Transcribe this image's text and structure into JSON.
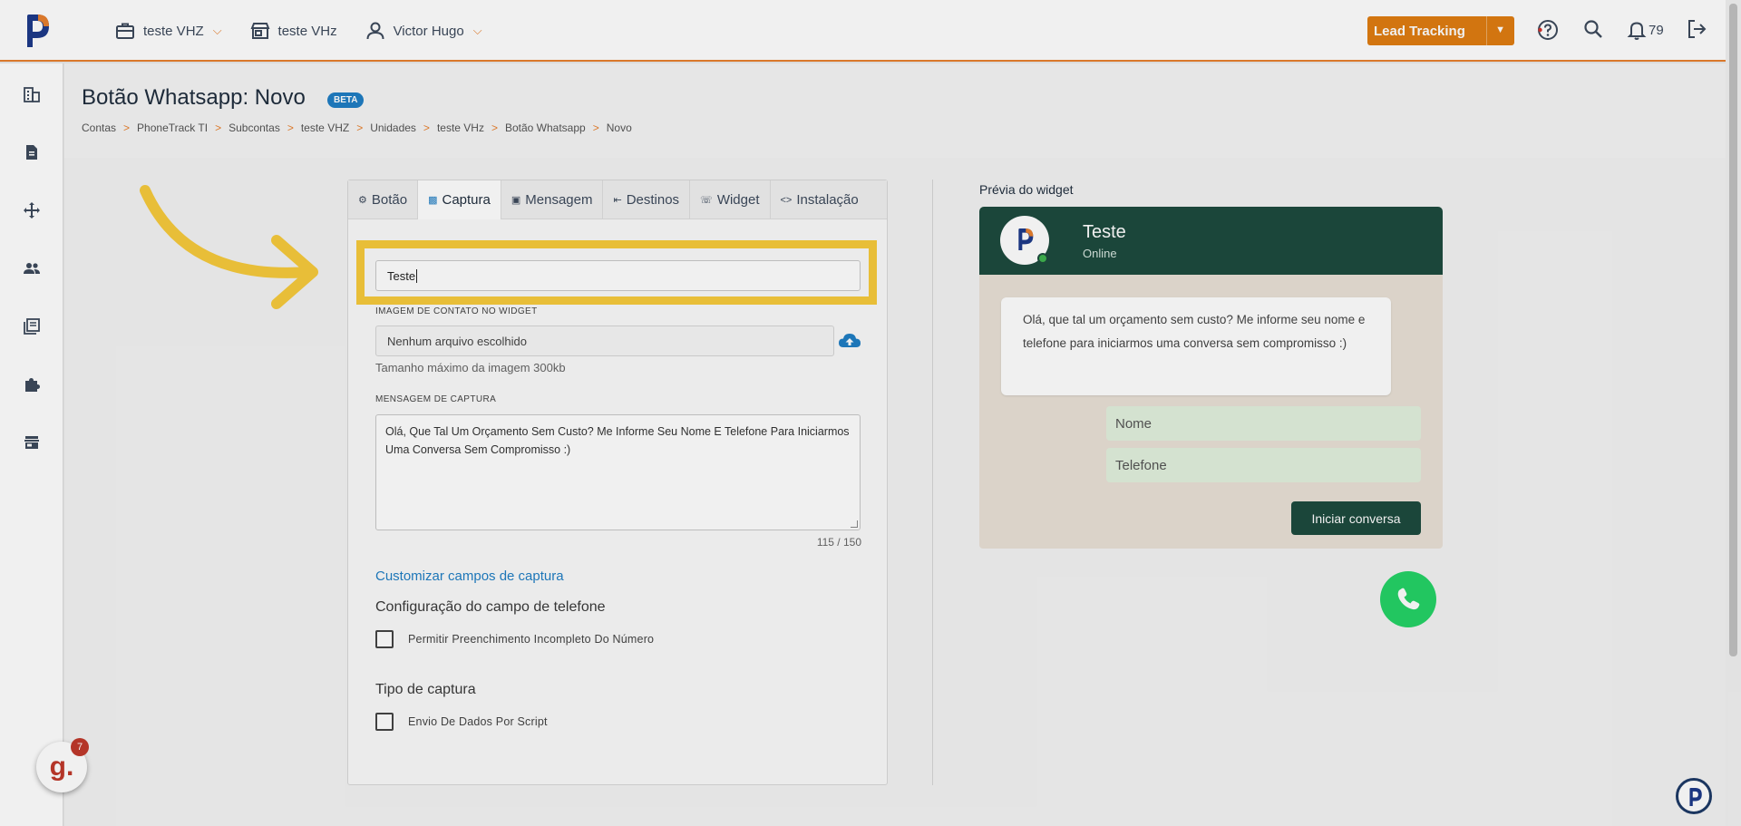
{
  "topbar": {
    "account": "teste VHZ",
    "unit": "teste VHz",
    "user": "Victor Hugo",
    "lead_button": "Lead Tracking",
    "notifications": "79"
  },
  "page": {
    "title": "Botão Whatsapp: Novo",
    "badge": "BETA",
    "breadcrumb": [
      "Contas",
      "PhoneTrack TI",
      "Subcontas",
      "teste VHZ",
      "Unidades",
      "teste VHz",
      "Botão Whatsapp",
      "Novo"
    ]
  },
  "tabs": [
    {
      "label": "Botão",
      "icon": "gear-icon"
    },
    {
      "label": "Captura",
      "icon": "form-icon"
    },
    {
      "label": "Mensagem",
      "icon": "message-icon"
    },
    {
      "label": "Destinos",
      "icon": "destinations-icon"
    },
    {
      "label": "Widget",
      "icon": "whatsapp-icon"
    },
    {
      "label": "Instalação",
      "icon": "code-icon"
    }
  ],
  "form": {
    "name_value": "Teste",
    "image_label": "IMAGEM DE CONTATO NO WIDGET",
    "file_text": "Nenhum arquivo escolhido",
    "image_hint": "Tamanho máximo da imagem 300kb",
    "message_label": "MENSAGEM DE CAPTURA",
    "message_value": "Olá, Que Tal Um Orçamento Sem Custo? Me Informe Seu Nome E Telefone Para Iniciarmos Uma Conversa Sem Compromisso :)",
    "counter": "115 / 150",
    "customize_link": "Customizar campos de captura",
    "phone_config_title": "Configuração do campo de telefone",
    "phone_config_option": "Permitir Preenchimento Incompleto Do Número",
    "capture_type_title": "Tipo de captura",
    "capture_type_option": "Envio De Dados Por Script"
  },
  "preview": {
    "title": "Prévia do widget",
    "contact_name": "Teste",
    "status": "Online",
    "message": "Olá, que tal um orçamento sem custo? Me informe seu nome e telefone para iniciarmos uma conversa sem compromisso :)",
    "name_placeholder": "Nome",
    "phone_placeholder": "Telefone",
    "button": "Iniciar conversa"
  },
  "support_badge": {
    "letter": "g.",
    "count": "7"
  },
  "colors": {
    "accent": "#e8802e",
    "brand_blue": "#1f7ec4",
    "whatsapp_dark": "#1d4b3e",
    "highlight": "#f7ca3c"
  }
}
